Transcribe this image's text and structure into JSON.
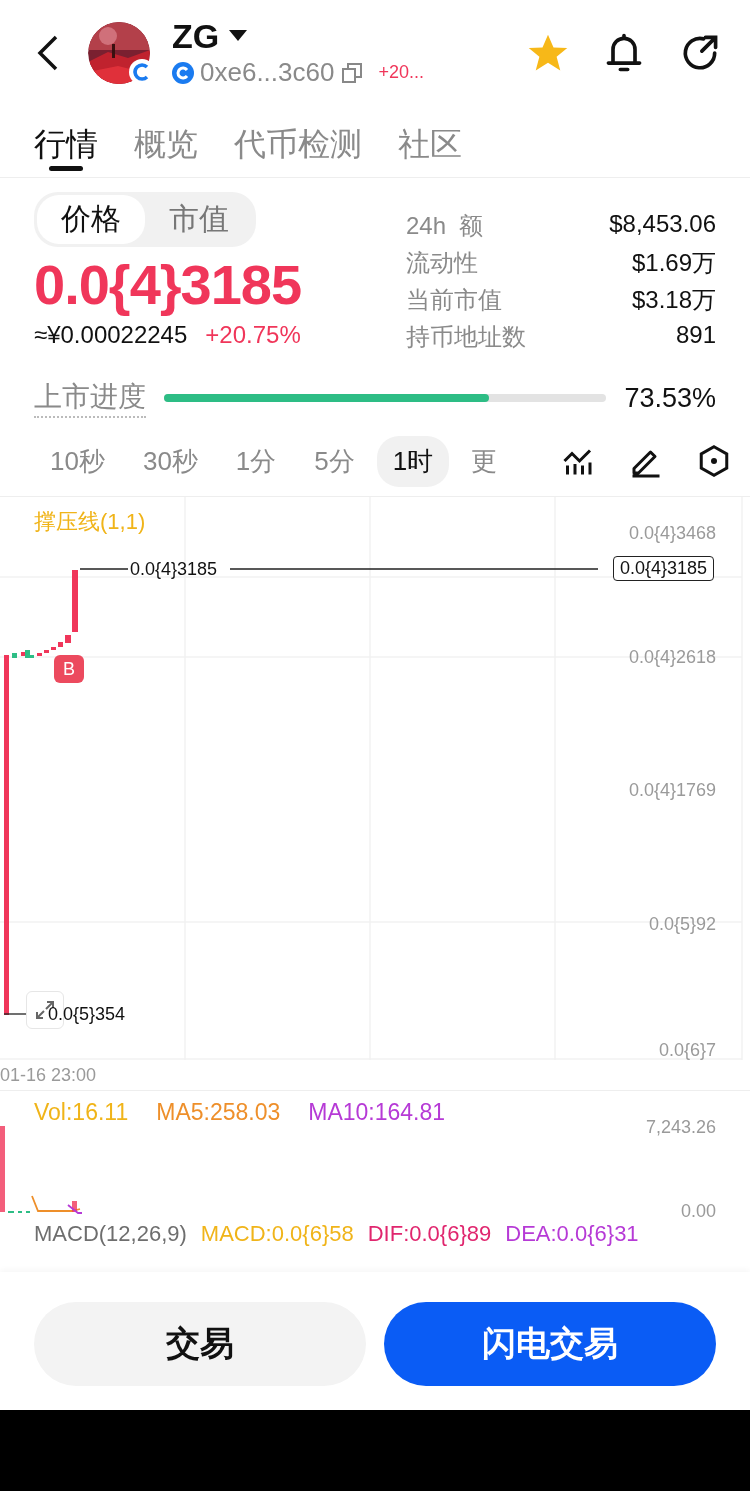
{
  "header": {
    "title": "ZG",
    "address": "0xe6...3c60",
    "change": "+20...",
    "favorite": true
  },
  "tabs": [
    {
      "label": "行情",
      "selected": true
    },
    {
      "label": "概览",
      "selected": false
    },
    {
      "label": "代币检测",
      "selected": false
    },
    {
      "label": "社区",
      "selected": false
    }
  ],
  "toggle": [
    {
      "label": "价格",
      "selected": true
    },
    {
      "label": "市值",
      "selected": false
    }
  ],
  "price": {
    "value": "0.0{4}3185",
    "fiat": "≈¥0.00022245",
    "change": "+20.75%"
  },
  "stats": [
    {
      "label": "24h  额",
      "value": "$8,453.06"
    },
    {
      "label": "流动性",
      "value": "$1.69万"
    },
    {
      "label": "当前市值",
      "value": "$3.18万"
    },
    {
      "label": "持币地址数",
      "value": "891"
    }
  ],
  "progress": {
    "label": "上市进度",
    "level": 0.7353,
    "reading": "73.53%"
  },
  "intervals": [
    {
      "label": "10秒",
      "selected": false
    },
    {
      "label": "30秒",
      "selected": false
    },
    {
      "label": "1分",
      "selected": false
    },
    {
      "label": "5分",
      "selected": false
    },
    {
      "label": "1时",
      "selected": true
    },
    {
      "label": "更",
      "selected": false
    }
  ],
  "chart": {
    "indicator": "撑压线(1,1)",
    "price_axis": [
      "0.0{4}3468",
      "0.0{4}2618",
      "0.0{4}1769",
      "0.0{5}92",
      "0.0{6}7"
    ],
    "current_price": "0.0{4}3185",
    "high_label": "0.0{4}3185",
    "low_label": "0.0{5}354",
    "marker": "B",
    "time_label": "01-16 23:00"
  },
  "volume": {
    "legend": [
      {
        "text": "Vol:16.11",
        "color": "#f0b419"
      },
      {
        "text": "MA5:258.03",
        "color": "#ee8f2a"
      },
      {
        "text": "MA10:164.81",
        "color": "#b63ad6"
      }
    ],
    "axis": [
      "7,243.26",
      "0.00"
    ]
  },
  "macd": [
    {
      "text": "MACD(12,26,9)",
      "color": "#6e6e6e"
    },
    {
      "text": "MACD:0.0{6}58",
      "color": "#f0b419"
    },
    {
      "text": "DIF:0.0{6}89",
      "color": "#e0266e"
    },
    {
      "text": "DEA:0.0{6}31",
      "color": "#b63ad6"
    }
  ],
  "buttons": [
    {
      "label": "交易",
      "kind": "secondary"
    },
    {
      "label": "闪电交易",
      "kind": "primary"
    }
  ]
}
